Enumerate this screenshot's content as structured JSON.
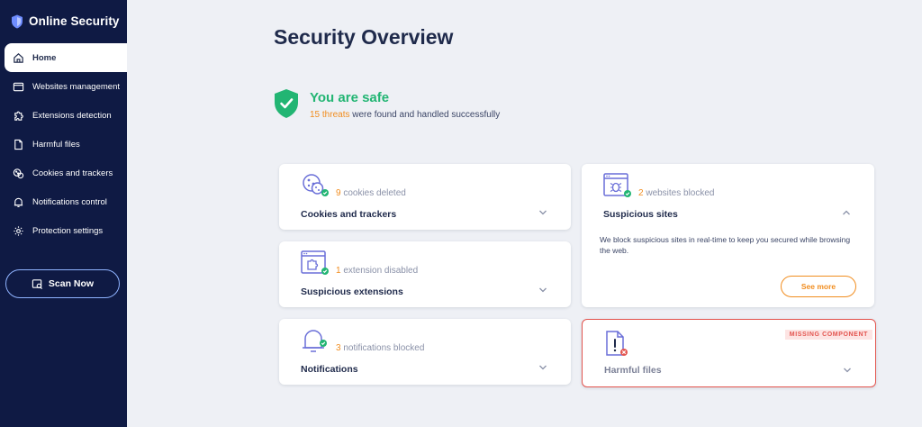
{
  "app": {
    "title": "Online Security"
  },
  "sidebar": {
    "items": [
      {
        "label": "Home",
        "icon": "home-icon"
      },
      {
        "label": "Websites management",
        "icon": "browser-window-icon"
      },
      {
        "label": "Extensions detection",
        "icon": "puzzle-icon"
      },
      {
        "label": "Harmful files",
        "icon": "file-icon"
      },
      {
        "label": "Cookies and trackers",
        "icon": "cookie-icon"
      },
      {
        "label": "Notifications control",
        "icon": "bell-icon"
      },
      {
        "label": "Protection settings",
        "icon": "gear-icon"
      }
    ],
    "scan_label": "Scan Now"
  },
  "main": {
    "title": "Security Overview",
    "status": {
      "title": "You are safe",
      "threats": "15 threats",
      "suffix": " were found and handled successfully"
    },
    "cards": {
      "cookies": {
        "count": "9",
        "stat": " cookies deleted",
        "title": "Cookies and trackers",
        "icon": "cookie-icon"
      },
      "sites": {
        "count": "2",
        "stat": " websites blocked",
        "title": "Suspicious sites",
        "icon": "bug-window-icon",
        "description": "We block suspicious sites in real-time to keep you secured while browsing the web.",
        "button": "See more"
      },
      "extensions": {
        "count": "1",
        "stat": " extension disabled",
        "title": "Suspicious extensions",
        "icon": "puzzle-window-icon"
      },
      "notifications": {
        "count": "3",
        "stat": " notifications blocked",
        "title": "Notifications",
        "icon": "bell-icon"
      },
      "files": {
        "badge": "MISSING COMPONENT",
        "title": "Harmful files",
        "icon": "file-warning-icon"
      }
    }
  },
  "colors": {
    "sidebar": "#0f1a44",
    "safe": "#22b573",
    "accent": "#f18d1f",
    "error": "#e3554f",
    "background": "#eef0f5"
  }
}
